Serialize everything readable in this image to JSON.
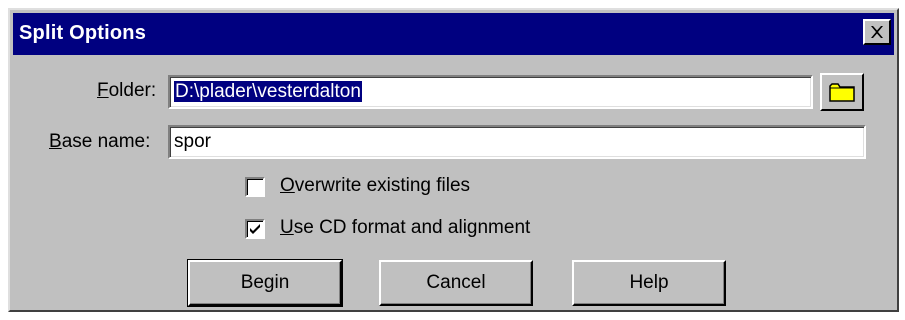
{
  "window": {
    "title": "Split Options",
    "close_icon": "close-icon"
  },
  "folder": {
    "label_accel": "F",
    "label_rest": "older:",
    "value": "D:\\plader\\vesterdalton",
    "selected": true,
    "browse_icon": "folder-icon"
  },
  "base_name": {
    "label_accel": "B",
    "label_rest": "ase name:",
    "value": "spor"
  },
  "options": {
    "overwrite": {
      "accel": "O",
      "rest": "verwrite existing files",
      "checked": false
    },
    "cd_format": {
      "accel": "U",
      "rest": "se CD format and alignment",
      "checked": true
    }
  },
  "buttons": {
    "begin": "Begin",
    "cancel": "Cancel",
    "help": "Help"
  },
  "colors": {
    "title_bar": "#000080",
    "face": "#c0c0c0",
    "selection": "#000080",
    "folder_icon": "#ffff00"
  }
}
